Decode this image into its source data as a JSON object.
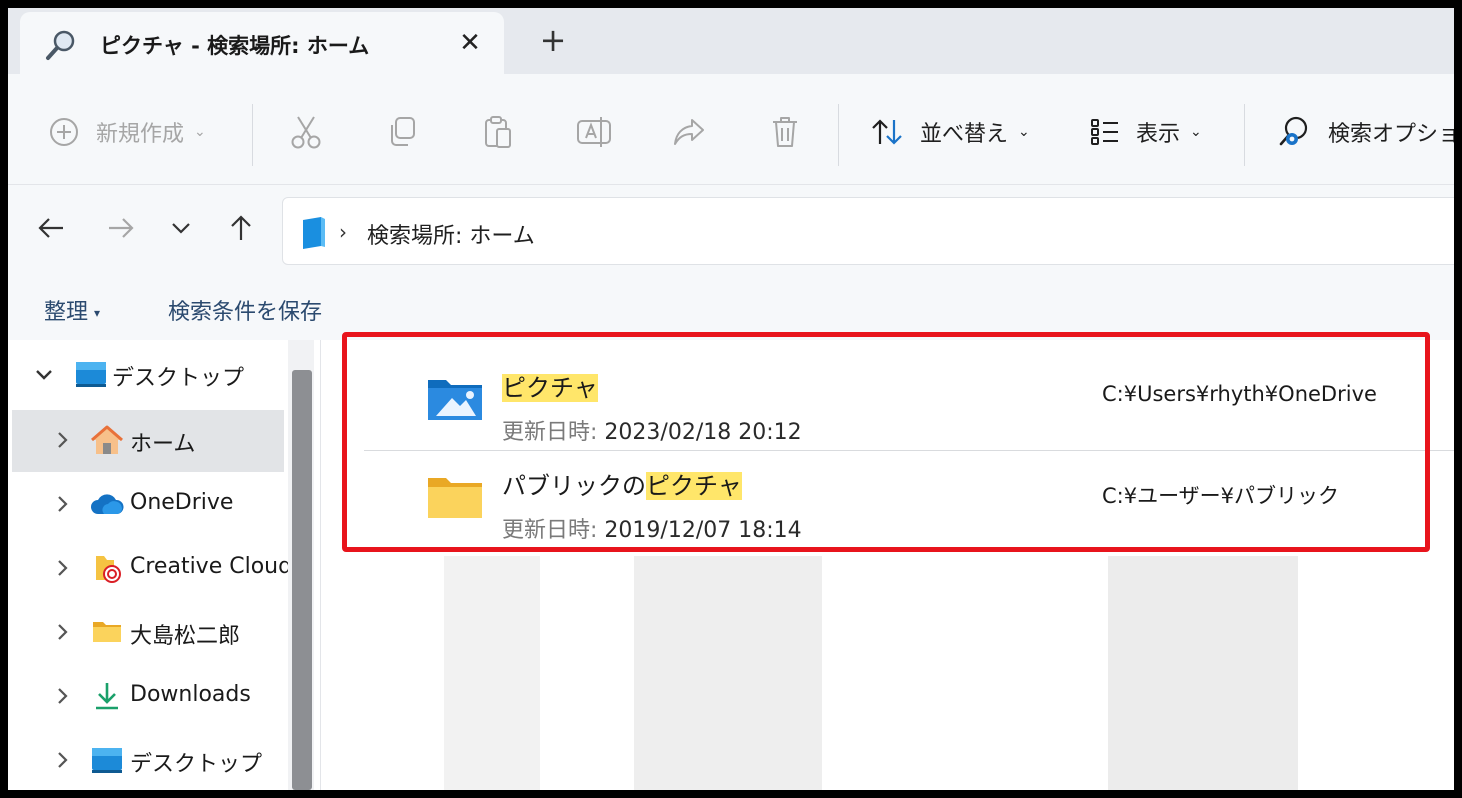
{
  "window": {
    "tab_title": "ピクチャ - 検索場所: ホーム",
    "tab_close": "✕",
    "new_tab": "+"
  },
  "toolbar": {
    "new_label": "新規作成",
    "sort_label": "並べ替え",
    "view_label": "表示",
    "search_options_label": "検索オプション",
    "chevron": "⌄"
  },
  "address": {
    "separator": "›",
    "location": "検索場所: ホーム"
  },
  "commands": {
    "organize": "整理",
    "save_search": "検索条件を保存",
    "caret": "▾"
  },
  "sidebar": {
    "items": [
      {
        "label": "デスクトップ",
        "expanded": true
      },
      {
        "label": "ホーム",
        "selected": true
      },
      {
        "label": "OneDrive"
      },
      {
        "label": "Creative Cloud"
      },
      {
        "label": "大島松二郎"
      },
      {
        "label": "Downloads"
      },
      {
        "label": "デスクトップ"
      }
    ]
  },
  "results": {
    "items": [
      {
        "name_highlight": "ピクチャ",
        "name_prefix": "",
        "date_label": "更新日時:",
        "date_value": "2023/02/18 20:12",
        "path": "C:¥Users¥rhyth¥OneDrive"
      },
      {
        "name_prefix": "パブリックの",
        "name_highlight": "ピクチャ",
        "date_label": "更新日時:",
        "date_value": "2019/12/07 18:14",
        "path": "C:¥ユーザー¥パブリック"
      }
    ]
  },
  "colors": {
    "highlight": "#ffe66a",
    "annotation_box": "#e8141c",
    "accent_blue": "#1a73c8",
    "folder_yellow": "#f5c342"
  }
}
